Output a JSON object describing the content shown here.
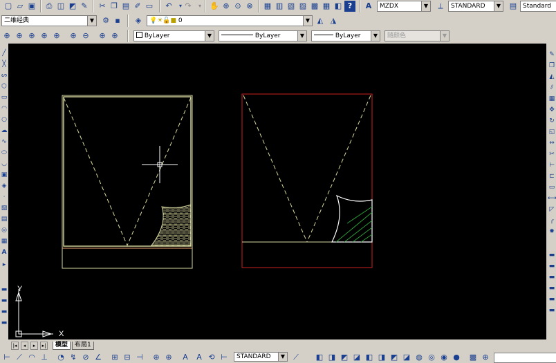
{
  "toolbar_top": {
    "text_style": "MZDX",
    "dim_style": "STANDARD",
    "table_style": "Standard"
  },
  "workspace": {
    "value": "二维经典"
  },
  "layer": {
    "current": "0"
  },
  "properties": {
    "color": "ByLayer",
    "linetype": "ByLayer",
    "lineweight": "ByLayer",
    "plotstyle": "随颜色"
  },
  "ucs": {
    "x_label": "X",
    "y_label": "Y"
  },
  "tabs": {
    "model": "模型",
    "layout1": "布局1"
  },
  "bottom": {
    "style": "STANDARD"
  },
  "colors": {
    "canvas": "#000000",
    "left_frame": "#d8d8a0",
    "right_frame": "#cc2020",
    "hatch_green": "#2e9a3a"
  },
  "icons": [
    "new-icon",
    "open-icon",
    "save-icon",
    "print-icon",
    "preview-icon",
    "publish-icon",
    "cut-icon",
    "copy-icon",
    "paste-icon",
    "match-icon",
    "undo-icon",
    "redo-icon",
    "pan-icon",
    "zoom-realtime-icon",
    "zoom-window-icon",
    "zoom-previous-icon",
    "properties-icon",
    "designcenter-icon",
    "toolpalette-icon",
    "sheetset-icon",
    "markup-icon",
    "calculator-icon",
    "help-icon"
  ]
}
